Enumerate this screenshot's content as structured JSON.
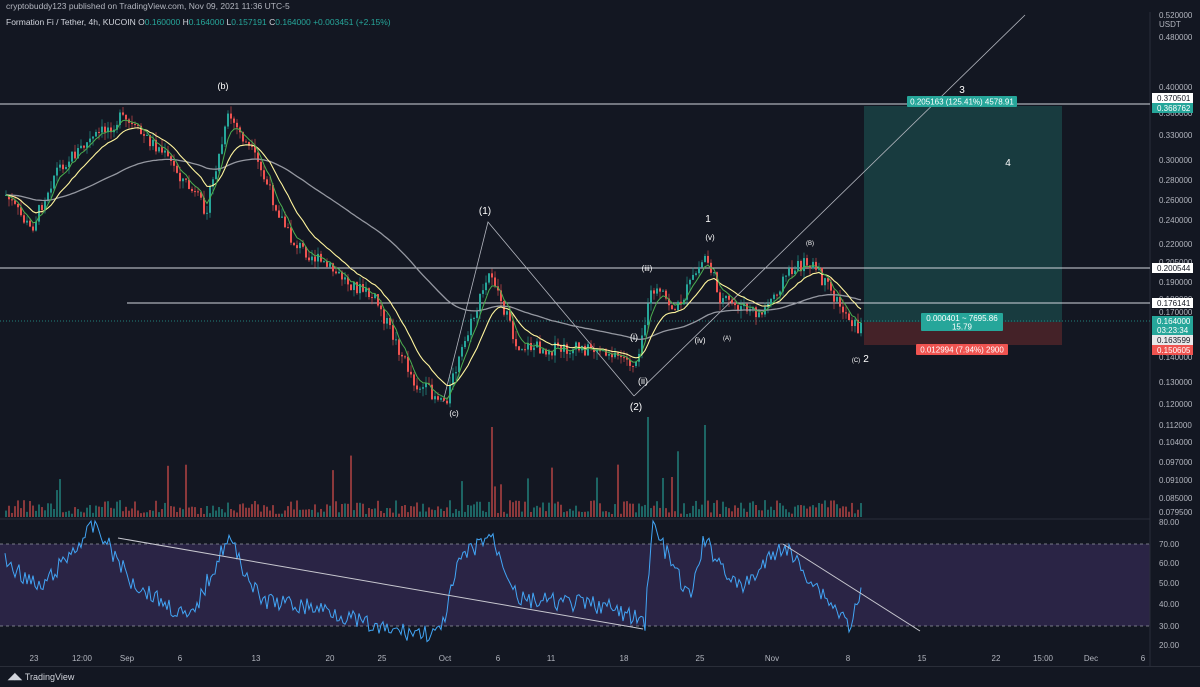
{
  "header": {
    "published": "cryptobuddy123 published on TradingView.com, Nov 09, 2021 11:36 UTC-5"
  },
  "legend": {
    "symbol": "Formation Fi / Tether, 4h, KUCOIN",
    "o_label": "O",
    "o": "0.160000",
    "h_label": "H",
    "h": "0.164000",
    "l_label": "L",
    "l": "0.157191",
    "c_label": "C",
    "c": "0.164000",
    "change": "+0.003451 (+2.15%)"
  },
  "price_axis": {
    "currency": "USDT",
    "ticks": [
      "0.520000",
      "0.480000",
      "0.400000",
      "0.360000",
      "0.330000",
      "0.300000",
      "0.280000",
      "0.260000",
      "0.240000",
      "0.220000",
      "0.205000",
      "0.190000",
      "0.180000",
      "0.170000",
      "0.160000",
      "0.150000",
      "0.140000",
      "0.130000",
      "0.120000",
      "0.112000",
      "0.104000",
      "0.097000",
      "0.091000",
      "0.085000",
      "0.079500"
    ],
    "badges": {
      "level_top": "0.370501",
      "target": "0.368762",
      "level_mid": "0.200544",
      "level_low": "0.176141",
      "current": "0.164000",
      "countdown": "03:23:34",
      "entry": "0.163599",
      "stop": "0.150605"
    }
  },
  "rsi_axis": {
    "ticks": [
      "80.00",
      "70.00",
      "60.00",
      "50.00",
      "40.00",
      "30.00",
      "20.00"
    ]
  },
  "time_axis": {
    "ticks": [
      "23",
      "12:00",
      "Sep",
      "6",
      "13",
      "20",
      "25",
      "Oct",
      "6",
      "11",
      "18",
      "25",
      "Nov",
      "8",
      "15",
      "22",
      "15:00",
      "Dec",
      "6"
    ]
  },
  "position": {
    "target_label": "0.205163 (125.41%) 4578.91",
    "entry_label_1": "0.000401 ~ 7695.86",
    "entry_label_2": "15.79",
    "stop_label": "0.012994 (7.94%) 2900"
  },
  "waves": {
    "b_upper": "(b)",
    "c_low": "(c)",
    "w1": "(1)",
    "w2": "(2)",
    "i": "(i)",
    "ii": "(ii)",
    "iii": "(iii)",
    "iv": "(iv)",
    "v": "(v)",
    "one": "1",
    "a": "(A)",
    "b": "(B)",
    "c_small": "(C)",
    "two": "2",
    "three": "3",
    "four": "4"
  },
  "colors": {
    "background": "#131722",
    "up": "#26a69a",
    "down": "#ef5350",
    "ema_fast": "#4caf50",
    "ema_slow": "#fff59d",
    "ma_long": "#9598a1",
    "rsi_line": "#42a5f5",
    "rsi_band": "#7e57c2",
    "target_zone": "#1c4e50",
    "stop_zone": "#4a2329"
  },
  "footer": {
    "brand": "TradingView"
  }
}
